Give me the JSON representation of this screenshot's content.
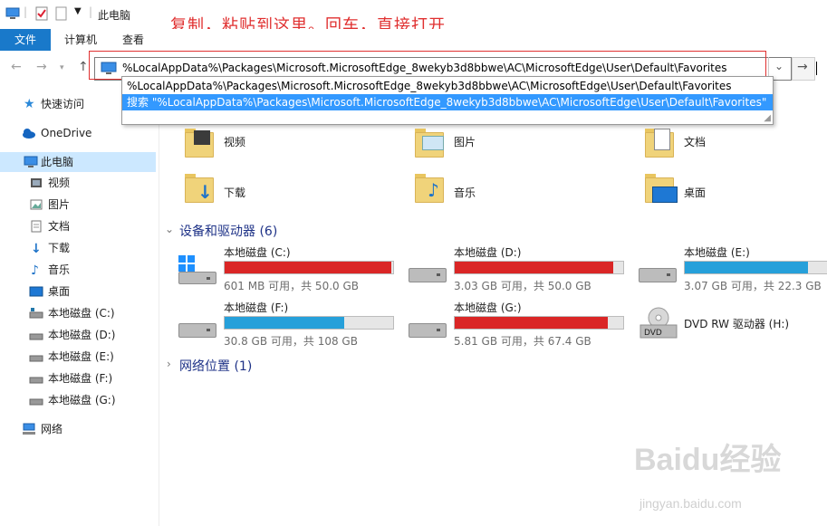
{
  "titlebar": {
    "title": "此电脑"
  },
  "ribbon": {
    "tabs": [
      "文件",
      "计算机",
      "查看"
    ]
  },
  "instruction": "复制，粘贴到这里。回车，直接打开",
  "address": {
    "value": "%LocalAppData%\\Packages\\Microsoft.MicrosoftEdge_8wekyb3d8bbwe\\AC\\MicrosoftEdge\\User\\Default\\Favorites",
    "suggestions": [
      "%LocalAppData%\\Packages\\Microsoft.MicrosoftEdge_8wekyb3d8bbwe\\AC\\MicrosoftEdge\\User\\Default\\Favorites",
      "搜索 \"%LocalAppData%\\Packages\\Microsoft.MicrosoftEdge_8wekyb3d8bbwe\\AC\\MicrosoftEdge\\User\\Default\\Favorites\""
    ]
  },
  "sidebar": {
    "items": [
      {
        "label": "快速访问",
        "icon": "star-icon"
      },
      {
        "label": "OneDrive",
        "icon": "cloud-icon"
      },
      {
        "label": "此电脑",
        "icon": "computer-icon"
      },
      {
        "label": "视频",
        "icon": "video-icon"
      },
      {
        "label": "图片",
        "icon": "picture-icon"
      },
      {
        "label": "文档",
        "icon": "document-icon"
      },
      {
        "label": "下载",
        "icon": "download-icon"
      },
      {
        "label": "音乐",
        "icon": "music-icon"
      },
      {
        "label": "桌面",
        "icon": "desktop-icon"
      },
      {
        "label": "本地磁盘 (C:)",
        "icon": "drive-icon"
      },
      {
        "label": "本地磁盘 (D:)",
        "icon": "drive-icon"
      },
      {
        "label": "本地磁盘 (E:)",
        "icon": "drive-icon"
      },
      {
        "label": "本地磁盘 (F:)",
        "icon": "drive-icon"
      },
      {
        "label": "本地磁盘 (G:)",
        "icon": "drive-icon"
      },
      {
        "label": "网络",
        "icon": "network-icon"
      }
    ]
  },
  "folders": [
    {
      "label": "视频"
    },
    {
      "label": "图片"
    },
    {
      "label": "文档"
    },
    {
      "label": "下载"
    },
    {
      "label": "音乐"
    },
    {
      "label": "桌面"
    }
  ],
  "devices": {
    "title": "设备和驱动器 (6)",
    "drives": [
      {
        "name": "本地磁盘 (C:)",
        "free": "601 MB 可用，共 50.0 GB",
        "used_fraction": 0.99,
        "color": "#da2626"
      },
      {
        "name": "本地磁盘 (D:)",
        "free": "3.03 GB 可用，共 50.0 GB",
        "used_fraction": 0.94,
        "color": "#da2626"
      },
      {
        "name": "本地磁盘 (E:)",
        "free": "3.07 GB 可用，共 22.3 GB",
        "used_fraction": 0.86,
        "color": "#26a0da"
      },
      {
        "name": "本地磁盘 (F:)",
        "free": "30.8 GB 可用，共 108 GB",
        "used_fraction": 0.71,
        "color": "#26a0da"
      },
      {
        "name": "本地磁盘 (G:)",
        "free": "5.81 GB 可用，共 67.4 GB",
        "used_fraction": 0.91,
        "color": "#da2626"
      },
      {
        "name": "DVD RW 驱动器 (H:)"
      }
    ]
  },
  "network": {
    "title": "网络位置 (1)"
  },
  "watermark": {
    "text": "Baidu经验",
    "url": "jingyan.baidu.com"
  }
}
